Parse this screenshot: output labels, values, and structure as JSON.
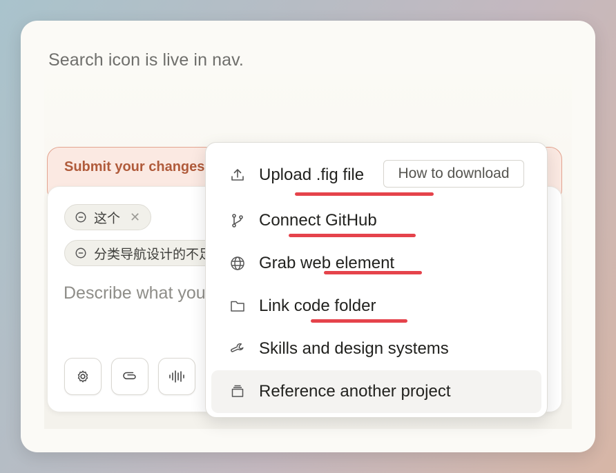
{
  "message": "Search icon is live in nav.",
  "banner": {
    "text": "Submit your changes"
  },
  "composer": {
    "chips": [
      {
        "label": "这个"
      },
      {
        "label": "分类导航设计的不足"
      }
    ],
    "placeholder": "Describe what you want",
    "tools": [
      "gear-icon",
      "paperclip-icon",
      "waveform-icon"
    ]
  },
  "menu": {
    "items": [
      {
        "label": "Upload .fig file",
        "icon": "upload-icon"
      },
      {
        "label": "Connect GitHub",
        "icon": "git-branch-icon"
      },
      {
        "label": "Grab web element",
        "icon": "globe-icon"
      },
      {
        "label": "Link code folder",
        "icon": "folder-icon"
      },
      {
        "label": "Skills and design systems",
        "icon": "wrench-icon"
      },
      {
        "label": "Reference another project",
        "icon": "stack-icon"
      }
    ],
    "how_to_download": "How to download"
  },
  "colors": {
    "annotation": "#e5434b",
    "banner_text": "#b05b3b"
  }
}
